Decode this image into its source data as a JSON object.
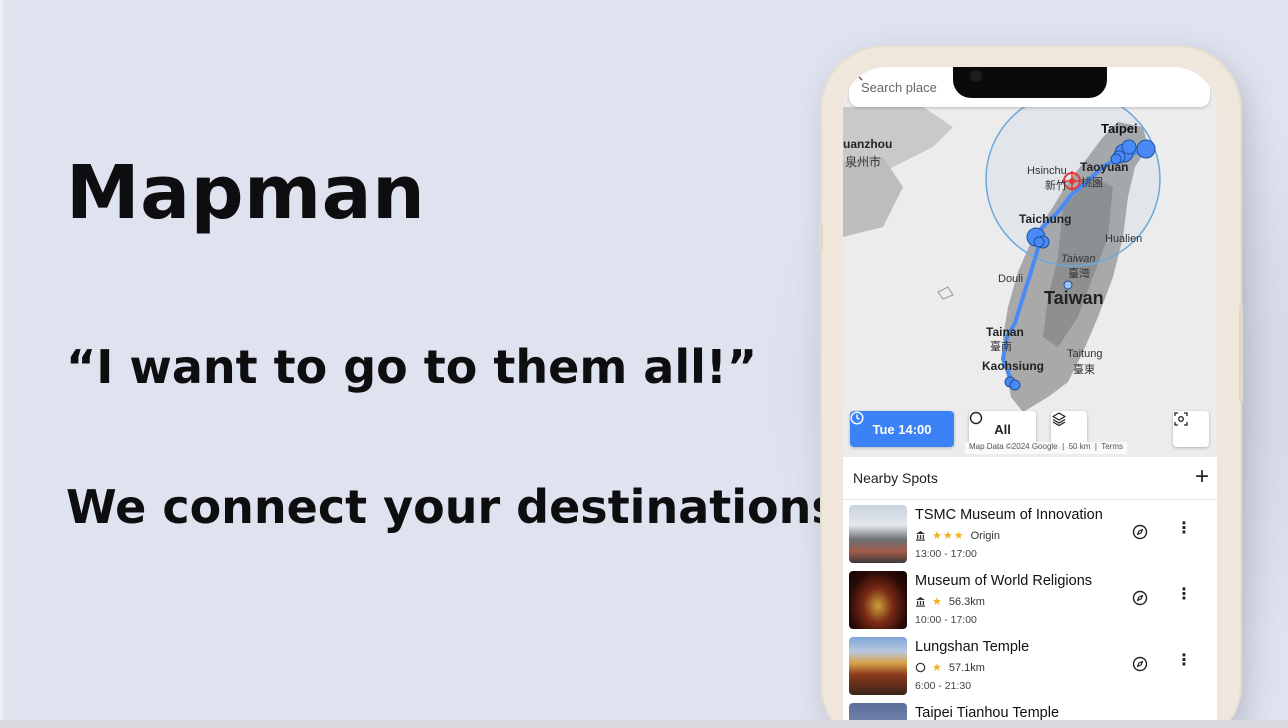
{
  "hero": {
    "title": "Mapman",
    "tagline": "“I want to go to them all!”",
    "subline": "We connect your destinations"
  },
  "app": {
    "search": {
      "placeholder": "Search place"
    },
    "map": {
      "labels": {
        "quanzhou": "uanzhou",
        "quanzhou_cn": "泉州市",
        "taipei": "Taipei",
        "hsinchu": "Hsinchu",
        "hsinchu_cn": "新竹",
        "taoyuan": "Taoyuan",
        "taoyuan_cn": "桃園",
        "taichung": "Taichung",
        "hualien": "Hualien",
        "taiwan_italic": "Taiwan",
        "taiwan_cn": "臺灣",
        "taiwan": "Taiwan",
        "douliu": "Douli",
        "tainan": "Tainan",
        "tainan_cn": "臺南",
        "taitung": "Taitung",
        "taitung_cn": "臺東",
        "kaohsiung": "Kaohsiung"
      },
      "controls": {
        "time_label": "Tue 14:00",
        "filter_label": "All"
      },
      "attribution": {
        "map_data": "Map Data ©2024 Google",
        "scale": "50 km",
        "terms": "Terms"
      },
      "colors": {
        "route": "#4a8af4",
        "accent": "#3b82f6",
        "origin_marker": "#e53935"
      }
    },
    "list": {
      "title": "Nearby Spots",
      "add_label": "+",
      "spots": [
        {
          "name": "TSMC Museum of Innovation",
          "type_icon": "museum-icon",
          "stars": "★★★",
          "detail": "Origin",
          "hours": "13:00 - 17:00"
        },
        {
          "name": "Museum of World Religions",
          "type_icon": "museum-icon",
          "stars": "★",
          "detail": "56.3km",
          "hours": "10:00 - 17:00"
        },
        {
          "name": "Lungshan Temple",
          "type_icon": "circle-icon",
          "stars": "★",
          "detail": "57.1km",
          "hours": "6:00 - 21:30"
        },
        {
          "name": "Taipei Tianhou Temple",
          "type_icon": "circle-icon",
          "stars": "",
          "detail": "",
          "hours": ""
        }
      ]
    }
  }
}
